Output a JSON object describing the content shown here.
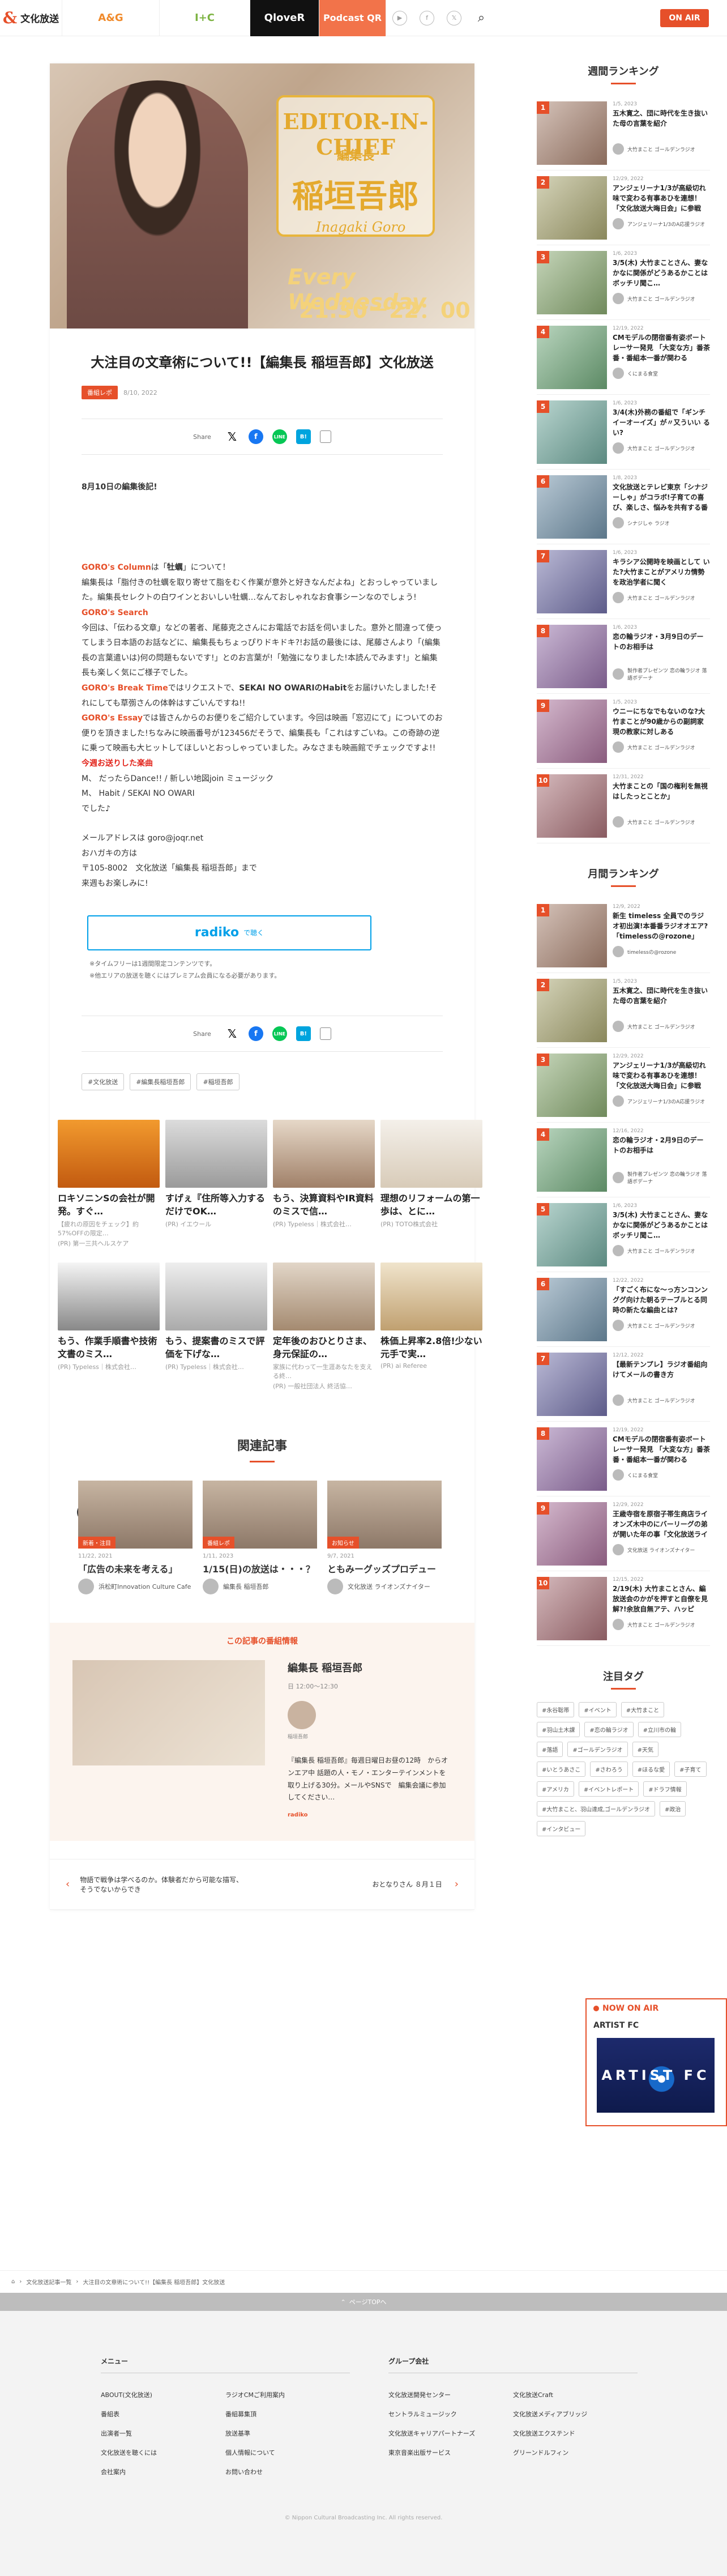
{
  "header": {
    "logo": "文化放送",
    "logo_sub": "JOQR",
    "brands": [
      "A&G",
      "I+C",
      "QloveR",
      "Podcast QR"
    ],
    "onair_label": "ON AIR"
  },
  "article": {
    "hero": {
      "editor_in_chief": "EDITOR-IN-CHIEF",
      "role": "編集長",
      "name": "稲垣吾郎",
      "romaji": "Inagaki Goro",
      "day": "Every Wednesday",
      "time": "21:30－22：00"
    },
    "title": "大注目の文章術について!!【編集長 稲垣吾郎】文化放送",
    "category": "番組レポ",
    "date": "8/10, 2022",
    "share_label": "Share",
    "lead": "8月10日の編集後記!",
    "p1": {
      "h": "GORO's Column",
      "t1": "は「",
      "b": "牡蠣",
      "t2": "」について！"
    },
    "p2": "編集長は「脂付きの牡蠣を取り寄せて脂をむく作業が意外と好きなんだよね」とおっしゃっていました。編集長セレクトの白ワインとおいしい牡蠣…なんておしゃれなお食事シーンなのでしょう!",
    "p3": {
      "h": "GORO's Search",
      "t": "今回は、「伝わる文章」などの著者、尾藤克之さんにお電話でお話を伺いました。意外と間違って使ってしまう日本語のお話などに、編集長もちょっぴりドキドキ?!お話の最後には、尾藤さんより「(編集長の言葉遣いは)何の問題もないです!」とのお言葉が!「勉強になりました!本読んでみます!」と編集長も楽しく気にご様子でした。"
    },
    "p4": {
      "h": "GORO's Break Time",
      "t1": "ではリクエストで、",
      "b": "SEKAI NO OWARIのHabit",
      "t2": "をお届けいたしました!それにしても草彅さんの体幹はすごいんですね!!"
    },
    "p5": {
      "h": "GORO's Essay",
      "t": "では皆さんからのお便りをご紹介しています。今回は映画「窓辺にて」についてのお便りを頂きました!ちなみに映画番号が123456だそうで、編集長も「これはすごいね。この奇跡の逆に乗って映画も大ヒットしてほしいとおっしゃっていました。みなさまも映画館でチェックですよ!!"
    },
    "songs_h": "今週お送りした楽曲",
    "songs": [
      "M、 だったらDance!! / 新しい地図join ミュージック",
      "M、 Habit / SEKAI NO OWARI",
      "でした♪"
    ],
    "mail": [
      "メールアドレスは goro@joqr.net",
      "おハガキの方は",
      "〒105-8002　文化放送「編集長 稲垣吾郎」まで",
      "来週もお楽しみに!"
    ],
    "radiko": {
      "logo": "radiko",
      "label": "で聴く"
    },
    "notes": [
      "※タイムフリーは1週間限定コンテンツです。",
      "※他エリアの放送を聴くにはプレミアム会員になる必要があります。"
    ],
    "tags": [
      "#文化放送",
      "#編集長稲垣吾郎",
      "#稲垣吾郎"
    ]
  },
  "ads": [
    {
      "title": "ロキソニンSの会社が開発。すぐ…",
      "source": "【疲れの原因をチェック】約57%OFFの限定…",
      "sub": "(PR) 第一三共ヘルスケア"
    },
    {
      "title": "すげぇ『住所等入力するだけでOK…",
      "source": "(PR) イエウール",
      "sub": ""
    },
    {
      "title": "もう、決算資料やIR資料のミスで信…",
      "source": "(PR) Typeless｜株式会社…",
      "sub": ""
    },
    {
      "title": "理想のリフォームの第一歩は、とに…",
      "source": "(PR) TOTO株式会社",
      "sub": ""
    },
    {
      "title": "もう、作業手順書や技術文書のミス…",
      "source": "(PR) Typeless｜株式会社…",
      "sub": ""
    },
    {
      "title": "もう、提案書のミスで評価を下げな…",
      "source": "(PR) Typeless｜株式会社…",
      "sub": ""
    },
    {
      "title": "定年後のおひとりさま、身元保証の…",
      "source": "家族に代わって一生涯あなたを支える終…",
      "sub": "(PR) 一般社団法人 終活協…"
    },
    {
      "title": "株価上昇率2.8倍!少ない元手で実…",
      "source": "(PR) ai Referee",
      "sub": ""
    }
  ],
  "related": {
    "heading": "関連記事",
    "items": [
      {
        "badge": "新着・注目",
        "date": "11/22, 2021",
        "title": "「広告の未来を考える」#1(11月15日",
        "channel": "浜松町Innovation Culture Cafe"
      },
      {
        "badge": "番組レポ",
        "date": "1/11, 2023",
        "title": "1/15(日)の放送は・・・？【編集長 稲垣",
        "channel": "編集長 稲垣吾郎"
      },
      {
        "badge": "お知らせ",
        "date": "9/7, 2021",
        "title": "ともみーグッズプロデューサー爆誕秒読",
        "channel": "文化放送 ライオンズナイター"
      }
    ]
  },
  "program": {
    "heading": "この記事の番組情報",
    "name": "編集長 稲垣吾郎",
    "time": "日 12:00～12:30",
    "caption": "稲垣吾郎",
    "desc": "『編集長 稲垣吾郎』毎週日曜日お昼の12時　からオンエア中 話題の人・モノ・エンターテインメントを取り上げる30分。メールやSNSで　編集会議に参加してください…",
    "link": "radiko"
  },
  "pager": {
    "prev": "物語で戦争は学べるのか。体験者だから可能な描写、そうでないからでき",
    "next": "おとなりさん ８月１日"
  },
  "sidebar": {
    "weekly_h": "週間ランキング",
    "weekly": [
      {
        "n": "1",
        "date": "1/5, 2023",
        "title": "五木寛之、団に時代を生き抜いた母の言葉を紹介",
        "ch": "大竹まこと ゴールデンラジオ"
      },
      {
        "n": "2",
        "date": "12/29, 2022",
        "title": "アンジェリーナ1/3が高級切れ味で変わる有事あひを連想！「文化放送大晦日会」に参戦",
        "ch": "アンジェリーナ1/3のA応援ラジオ"
      },
      {
        "n": "3",
        "date": "1/6, 2023",
        "title": "3/5(木) 大竹まことさん、妻なかなに関係がどうあるかことはボッチリ聞こ…",
        "ch": "大竹まこと ゴールデンラジオ"
      },
      {
        "n": "4",
        "date": "12/19, 2022",
        "title": "CMモデルの閉宿番有姿ボートレーサー発見 「大変な方」番茶番・番組本一番が関わる",
        "ch": "くにまる食堂"
      },
      {
        "n": "5",
        "date": "1/6, 2023",
        "title": "3/4(木)外務の番組で「ギンチイーオーイズ」が〃又ういい るい?",
        "ch": "大竹まこと ゴールデンラジオ"
      },
      {
        "n": "6",
        "date": "1/8, 2023",
        "title": "文化放送とテレビ東京「シナジーしゃ」がコラボ!子育ての喜び、楽しさ、悩みを共有する番組",
        "ch": "シナジしゃ ラジオ"
      },
      {
        "n": "7",
        "date": "1/6, 2023",
        "title": "キラシア公開時を映画として いた?大竹まことがアメリカ情勢を政治学者に聞く",
        "ch": "大竹まこと ゴールデンラジオ"
      },
      {
        "n": "8",
        "date": "1/6, 2023",
        "title": "恋の輪ラジオ・3月9日のデートのお相手は",
        "ch": "製作者プレゼンツ 恋の輪ラジオ 落語ボデーナ"
      },
      {
        "n": "9",
        "date": "1/5, 2023",
        "title": "ウニーにちなでもないのな?大竹まことが90歳からの副詞家現の教家に対しある",
        "ch": "大竹まこと ゴールデンラジオ"
      },
      {
        "n": "10",
        "date": "12/31, 2022",
        "title": "大竹まことの「国の権利を無視 はしたっとことか」",
        "ch": "大竹まこと ゴールデンラジオ"
      }
    ],
    "monthly_h": "月間ランキング",
    "monthly": [
      {
        "n": "1",
        "date": "12/9, 2022",
        "title": "新生 timeless 全員でのラジオ初出演!本番番ラジオオエア?「timelessの@rozone」",
        "ch": "timelessの@rozone"
      },
      {
        "n": "2",
        "date": "1/5, 2023",
        "title": "五木寛之、団に時代を生き抜いた母の言葉を紹介",
        "ch": "大竹まこと ゴールデンラジオ"
      },
      {
        "n": "3",
        "date": "12/29, 2022",
        "title": "アンジェリーナ1/3が高級切れ味で変わる有事あひを連想！「文化放送大晦日会」に参戦",
        "ch": "アンジェリーナ1/3のA応援ラジオ"
      },
      {
        "n": "4",
        "date": "12/16, 2022",
        "title": "恋の輪ラジオ・2月9日のデートのお相手は",
        "ch": "製作者プレゼンツ 恋の輪ラジオ 落語ボデーナ"
      },
      {
        "n": "5",
        "date": "1/6, 2023",
        "title": "3/5(木) 大竹まことさん、妻なかなに関係がどうあるかことはボッチリ聞こ…",
        "ch": "大竹まこと ゴールデンラジオ"
      },
      {
        "n": "6",
        "date": "12/22, 2022",
        "title": "「すごく布にな～っ方ンコンンググ向けた朝るテーブルとる同時の新たな編曲とは?",
        "ch": "大竹まこと ゴールデンラジオ"
      },
      {
        "n": "7",
        "date": "12/12, 2022",
        "title": "【最新テンプレ】ラジオ番組向けてメールの書き方",
        "ch": "大竹まこと ゴールデンラジオ"
      },
      {
        "n": "8",
        "date": "12/19, 2022",
        "title": "CMモデルの閉宿番有姿ボートレーサー発見 「大変な方」番茶番・番組本一番が関わる",
        "ch": "くにまる食堂"
      },
      {
        "n": "9",
        "date": "12/29, 2022",
        "title": "王歳寺宿を原宿子帯生商店ライオンズ木中のにバーリーグの弟が開いた年の事「文化放送ライオンズ",
        "ch": "文化放送 ライオンズナイター"
      },
      {
        "n": "10",
        "date": "12/15, 2022",
        "title": "2/19(木) 大竹まことさん、編放送会のかがを押すと自僚を見解?!余放自無アテ、ハッピ",
        "ch": "大竹まこと ゴールデンラジオ"
      }
    ],
    "tags_h": "注目タグ",
    "tags": [
      "#永谷聡帯",
      "#イベント",
      "#大竹まこと",
      "#羽山土木課",
      "#恋の輪ラジオ",
      "#立川市の輪",
      "#落語",
      "#ゴールデンラジオ",
      "#天気",
      "#いとうあさこ",
      "#さわろう",
      "#ほるな愛",
      "#子育て",
      "#アメリカ",
      "#イベントレポート",
      "#ドラフ情報",
      "#大竹まこと、羽山達成,ゴールデンラジオ",
      "#政治",
      "#インタビュー"
    ]
  },
  "onair": {
    "label": "NOW ON AIR",
    "program": "ARTIST FC",
    "logo": "ARTIST FC"
  },
  "breadcrumb": [
    "文化放送記事一覧",
    "大注目の文章術について!!【編集長 稲垣吾郎】文化放送"
  ],
  "pagetop": "ページTOPへ",
  "footer": {
    "menu_h": "メニュー",
    "menu": [
      "ABOUT(文化放送)",
      "ラジオCMご利用案内",
      "番組表",
      "番組募集頂",
      "出演者一覧",
      "放送基準",
      "文化放送を聴くには",
      "個人情報について",
      "会社案内",
      "お問い合わせ"
    ],
    "group_h": "グループ会社",
    "group": [
      "文化放送開発センター",
      "文化放送Craft",
      "セントラルミュージック",
      "文化放送メディアブリッジ",
      "文化放送キャリアパートナーズ",
      "文化放送エクステンド",
      "東京音楽出版サービス",
      "グリーンドルフィン"
    ],
    "copyright": "© Nippon Cultural Broadcasting Inc. All rights reserved."
  }
}
